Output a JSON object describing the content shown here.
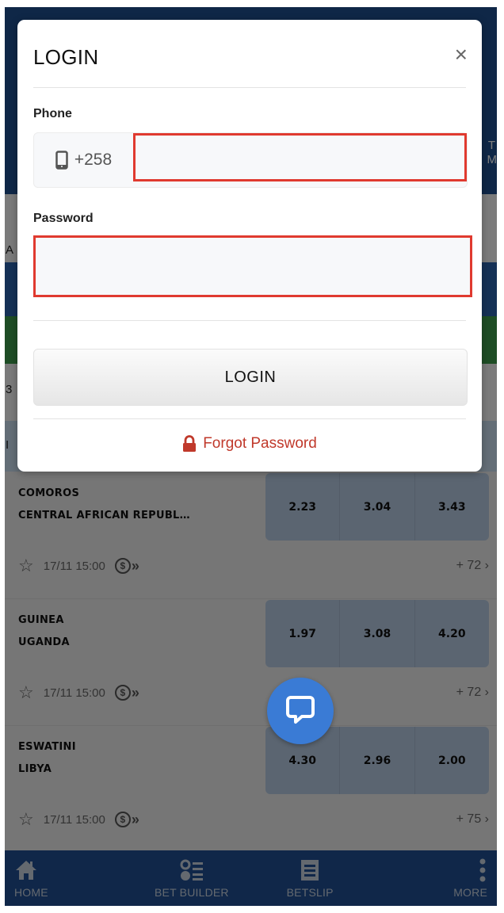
{
  "modal": {
    "title": "LOGIN",
    "close_label": "×",
    "phone_label": "Phone",
    "phone_prefix": "+258",
    "phone_value": "",
    "password_label": "Password",
    "password_value": "",
    "login_button": "LOGIN",
    "forgot_password": "Forgot Password",
    "colors": {
      "highlight_border": "#e03a2f",
      "forgot_text": "#c0392b"
    }
  },
  "background": {
    "peek_right_top": "T",
    "peek_right_bottom": "M",
    "peek_left_a": "A",
    "peek_left_b": "3",
    "peek_left_c": "I"
  },
  "matches": [
    {
      "home": "COMOROS",
      "away": "CENTRAL AFRICAN REPUBL…",
      "odds": [
        "2.23",
        "3.04",
        "3.43"
      ],
      "datetime": "17/11 15:00",
      "more_markets": "+ 72"
    },
    {
      "home": "GUINEA",
      "away": "UGANDA",
      "odds": [
        "1.97",
        "3.08",
        "4.20"
      ],
      "datetime": "17/11 15:00",
      "more_markets": "+ 72"
    },
    {
      "home": "ESWATINI",
      "away": "LIBYA",
      "odds": [
        "4.30",
        "2.96",
        "2.00"
      ],
      "datetime": "17/11 15:00",
      "more_markets": "+ 75"
    }
  ],
  "icons": {
    "star": "☆",
    "chevron": "›",
    "cash_out": "$",
    "cash_arrows": "»"
  },
  "bottom_nav": [
    {
      "label": "HOME",
      "icon": "home-icon"
    },
    {
      "label": "BET BUILDER",
      "icon": "bet-builder-icon"
    },
    {
      "label": "BETSLIP",
      "icon": "betslip-icon"
    },
    {
      "label": "MORE",
      "icon": "more-icon"
    }
  ],
  "chat": {
    "icon": "chat-icon",
    "color": "#3a7bd5"
  }
}
